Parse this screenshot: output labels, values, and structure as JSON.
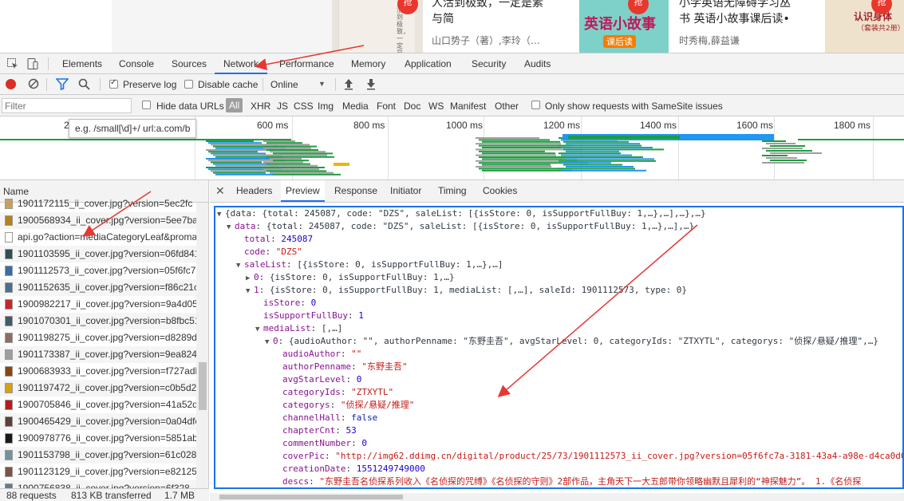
{
  "page_top": {
    "book1_badge": "抢",
    "book1_title_line1": "人活到极致，一定是素",
    "book1_title_line2": "与简",
    "book1_author": "山口势子（著）,李玲（…",
    "book1_cover_text": "活到极致，一定是素与简",
    "book2_badge": "抢",
    "book2_title_line1": "小学英语无障碍学习丛",
    "book2_title_line2": "书 英语小故事课后读•",
    "book2_author": "时秀梅,薛益谦",
    "book2_cover_text": "英语小故事",
    "book2_cover_sub": "课后读",
    "book3_badge": "抢",
    "book3_cover_title": "认识身体",
    "book3_cover_sub": "（套装共2册）"
  },
  "devtools": {
    "tabs": [
      "Elements",
      "Console",
      "Sources",
      "Network",
      "Performance",
      "Memory",
      "Application",
      "Security",
      "Audits"
    ],
    "active_tab": "Network",
    "toolbar": {
      "preserve_log": "Preserve log",
      "disable_cache": "Disable cache",
      "throttle": "Online"
    },
    "filter": {
      "placeholder": "Filter",
      "hide_data_urls": "Hide data URLs",
      "types": [
        "All",
        "XHR",
        "JS",
        "CSS",
        "Img",
        "Media",
        "Font",
        "Doc",
        "WS",
        "Manifest",
        "Other"
      ],
      "samesite": "Only show requests with SameSite issues"
    },
    "tooltip": "e.g. /small[\\d]+/ url:a.com/b",
    "timeline_ticks": [
      "2",
      "600 ms",
      "800 ms",
      "1000 ms",
      "1200 ms",
      "1400 ms",
      "1600 ms",
      "1800 ms"
    ],
    "name_header": "Name",
    "requests": [
      "1901172115_ii_cover.jpg?version=5ec2fc",
      "1900568934_ii_cover.jpg?version=5ee7ba..",
      "api.go?action=mediaCategoryLeaf&proma",
      "1901103595_ii_cover.jpg?version=06fd841",
      "1901112573_ii_cover.jpg?version=05f6fc7..",
      "1901152635_ii_cover.jpg?version=f86c21c",
      "1900982217_ii_cover.jpg?version=9a4d05..",
      "1901070301_ii_cover.jpg?version=b8fbc51",
      "1901198275_ii_cover.jpg?version=d8289d",
      "1901173387_ii_cover.jpg?version=9ea824f",
      "1900683933_ii_cover.jpg?version=f727adb",
      "1901197472_ii_cover.jpg?version=c0b5d2..",
      "1900705846_ii_cover.jpg?version=41a52d..",
      "1900465429_ii_cover.jpg?version=0a04dfc",
      "1900978776_ii_cover.jpg?version=5851ab..",
      "1901153798_ii_cover.jpg?version=61c028(",
      "1901123129_ii_cover.jpg?version=e82125..",
      "1900756838_ii_cover.jpg?version=6f328"
    ],
    "status": {
      "requests": "88 requests",
      "transferred": "813 KB transferred",
      "resources": "1.7 MB res"
    },
    "detail_tabs": [
      "Headers",
      "Preview",
      "Response",
      "Initiator",
      "Timing",
      "Cookies"
    ],
    "active_detail_tab": "Preview",
    "preview_lines": [
      {
        "indent": 0,
        "tri": "▼",
        "key": "",
        "sep": "",
        "value": "{data: {total: 245087, code: \"DZS\", saleList: [{isStore: 0, isSupportFullBuy: 1,…},…],…},…}",
        "type": "p"
      },
      {
        "indent": 1,
        "tri": "▼",
        "key": "data",
        "sep": ": ",
        "value": "{total: 245087, code: \"DZS\", saleList: [{isStore: 0, isSupportFullBuy: 1,…},…],…}",
        "type": "p"
      },
      {
        "indent": 2,
        "tri": "",
        "key": "total",
        "sep": ": ",
        "value": "245087",
        "type": "n"
      },
      {
        "indent": 2,
        "tri": "",
        "key": "code",
        "sep": ": ",
        "value": "\"DZS\"",
        "type": "s"
      },
      {
        "indent": 2,
        "tri": "▼",
        "key": "saleList",
        "sep": ": ",
        "value": "[{isStore: 0, isSupportFullBuy: 1,…},…]",
        "type": "p"
      },
      {
        "indent": 3,
        "tri": "▶",
        "key": "0",
        "sep": ": ",
        "value": "{isStore: 0, isSupportFullBuy: 1,…}",
        "type": "p"
      },
      {
        "indent": 3,
        "tri": "▼",
        "key": "1",
        "sep": ": ",
        "value": "{isStore: 0, isSupportFullBuy: 1, mediaList: [,…], saleId: 1901112573, type: 0}",
        "type": "p"
      },
      {
        "indent": 4,
        "tri": "",
        "key": "isStore",
        "sep": ": ",
        "value": "0",
        "type": "n"
      },
      {
        "indent": 4,
        "tri": "",
        "key": "isSupportFullBuy",
        "sep": ": ",
        "value": "1",
        "type": "n"
      },
      {
        "indent": 4,
        "tri": "▼",
        "key": "mediaList",
        "sep": ": ",
        "value": "[,…]",
        "type": "p"
      },
      {
        "indent": 5,
        "tri": "▼",
        "key": "0",
        "sep": ": ",
        "value": "{audioAuthor: \"\", authorPenname: \"东野圭吾\", avgStarLevel: 0, categoryIds: \"ZTXYTL\", categorys: \"侦探/悬疑/推理\",…}",
        "type": "p"
      },
      {
        "indent": 6,
        "tri": "",
        "key": "audioAuthor",
        "sep": ": ",
        "value": "\"\"",
        "type": "s"
      },
      {
        "indent": 6,
        "tri": "",
        "key": "authorPenname",
        "sep": ": ",
        "value": "\"东野圭吾\"",
        "type": "s"
      },
      {
        "indent": 6,
        "tri": "",
        "key": "avgStarLevel",
        "sep": ": ",
        "value": "0",
        "type": "n"
      },
      {
        "indent": 6,
        "tri": "",
        "key": "categoryIds",
        "sep": ": ",
        "value": "\"ZTXYTL\"",
        "type": "s"
      },
      {
        "indent": 6,
        "tri": "",
        "key": "categorys",
        "sep": ": ",
        "value": "\"侦探/悬疑/推理\"",
        "type": "s"
      },
      {
        "indent": 6,
        "tri": "",
        "key": "channelHall",
        "sep": ": ",
        "value": "false",
        "type": "b"
      },
      {
        "indent": 6,
        "tri": "",
        "key": "chapterCnt",
        "sep": ": ",
        "value": "53",
        "type": "n"
      },
      {
        "indent": 6,
        "tri": "",
        "key": "commentNumber",
        "sep": ": ",
        "value": "0",
        "type": "n"
      },
      {
        "indent": 6,
        "tri": "",
        "key": "coverPic",
        "sep": ": ",
        "value": "\"http://img62.ddimg.cn/digital/product/25/73/1901112573_ii_cover.jpg?version=05f6fc7a-3181-43a4-a98e-d4ca0d07",
        "type": "s"
      },
      {
        "indent": 6,
        "tri": "",
        "key": "creationDate",
        "sep": ": ",
        "value": "1551249749000",
        "type": "n"
      },
      {
        "indent": 6,
        "tri": "",
        "key": "descs",
        "sep": ": ",
        "value": "\"东野圭吾名侦探系列收入《名侦探的咒缚》《名侦探的守则》2部作品，主角天下一大五郎带你领略幽默且犀利的“神探魅力”。 1.《名侦探",
        "type": "s"
      },
      {
        "indent": 6,
        "tri": "",
        "key": "editorRecommend",
        "sep": ": ",
        "value": "\"\"",
        "type": "s"
      }
    ]
  },
  "colors": {
    "accent": "#1a73e8",
    "record": "#d93025",
    "arrow": "#e53935"
  }
}
